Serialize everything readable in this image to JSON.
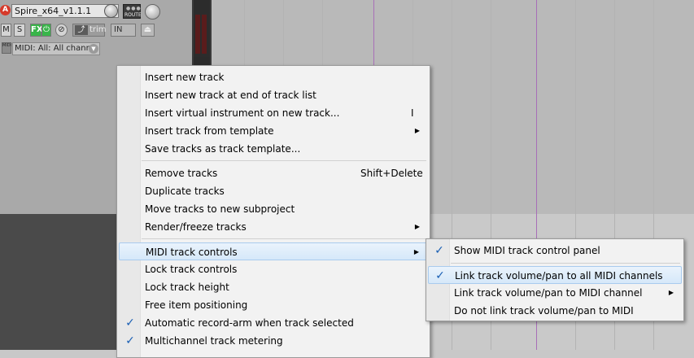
{
  "track": {
    "rec_label": "A",
    "name": "Spire_x64_v1.1.1",
    "route_label": "ROUTE",
    "mute_label": "M",
    "solo_label": "S",
    "fx_label": "FX",
    "power_glyph": "⏻",
    "phase_glyph": "⊘",
    "trim_label": "trim",
    "input_label": "IN",
    "midi_icon_label": "MIDI",
    "midi_channel": "MIDI: All: All chann",
    "dropdown_glyph": "▼"
  },
  "context_menu": {
    "items": [
      {
        "label": "Insert new track",
        "shortcut": "",
        "submenu": false,
        "checked": false
      },
      {
        "label": "Insert new track at end of track list",
        "shortcut": "",
        "submenu": false,
        "checked": false
      },
      {
        "label": "Insert virtual instrument on new track...",
        "shortcut": "I",
        "submenu": false,
        "checked": false
      },
      {
        "label": "Insert track from template",
        "shortcut": "",
        "submenu": true,
        "checked": false
      },
      {
        "label": "Save tracks as track template...",
        "shortcut": "",
        "submenu": false,
        "checked": false
      },
      {
        "label": "Remove tracks",
        "shortcut": "Shift+Delete",
        "submenu": false,
        "checked": false
      },
      {
        "label": "Duplicate tracks",
        "shortcut": "",
        "submenu": false,
        "checked": false
      },
      {
        "label": "Move tracks to new subproject",
        "shortcut": "",
        "submenu": false,
        "checked": false
      },
      {
        "label": "Render/freeze tracks",
        "shortcut": "",
        "submenu": true,
        "checked": false
      },
      {
        "label": "MIDI track controls",
        "shortcut": "",
        "submenu": true,
        "checked": false,
        "highlighted": true
      },
      {
        "label": "Lock track controls",
        "shortcut": "",
        "submenu": false,
        "checked": false
      },
      {
        "label": "Lock track height",
        "shortcut": "",
        "submenu": false,
        "checked": false
      },
      {
        "label": "Free item positioning",
        "shortcut": "",
        "submenu": false,
        "checked": false
      },
      {
        "label": "Automatic record-arm when track selected",
        "shortcut": "",
        "submenu": false,
        "checked": true
      },
      {
        "label": "Multichannel track metering",
        "shortcut": "",
        "submenu": false,
        "checked": true
      }
    ],
    "arrow_glyph": "▶",
    "check_glyph": "✓"
  },
  "submenu": {
    "items": [
      {
        "label": "Show MIDI track control panel",
        "checked": true,
        "submenu": false
      },
      {
        "label": "Link track volume/pan to all MIDI channels",
        "checked": true,
        "submenu": false,
        "highlighted": true
      },
      {
        "label": "Link track volume/pan to MIDI channel",
        "checked": false,
        "submenu": true
      },
      {
        "label": "Do not link track volume/pan to MIDI",
        "checked": false,
        "submenu": false
      }
    ]
  },
  "colors": {
    "record_arm": "#d63a2a",
    "fx_active": "#39b54a",
    "check": "#1a5fb4",
    "highlight": "#d6e8f9",
    "grid_marker": "#a86fb8"
  }
}
